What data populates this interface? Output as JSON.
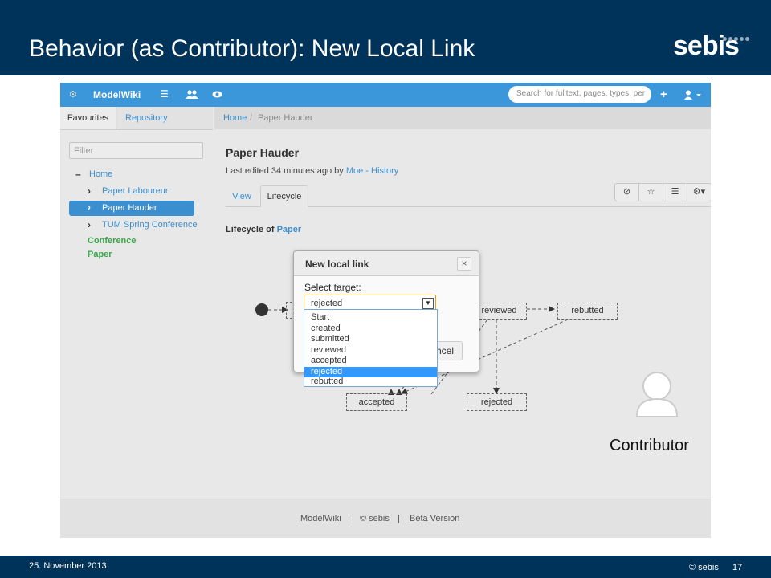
{
  "slide": {
    "title": "Behavior (as Contributor): New Local Link",
    "logo": "sebis",
    "footer_date": "25. November 2013",
    "footer_copyright": "© sebis",
    "page_number": "17"
  },
  "navbar": {
    "brand": "ModelWiki",
    "search_placeholder": "Search for fulltext, pages, types, per",
    "icons": [
      "cogs-icon",
      "list-icon",
      "users-icon",
      "eye-icon",
      "plus-icon",
      "user-icon"
    ]
  },
  "sidebar": {
    "tabs": [
      {
        "label": "Favourites",
        "active": true
      },
      {
        "label": "Repository",
        "active": false
      }
    ],
    "filter_placeholder": "Filter",
    "tree": {
      "root": "Home",
      "children": [
        {
          "label": "Paper Laboureur",
          "selected": false
        },
        {
          "label": "Paper Hauder",
          "selected": true
        },
        {
          "label": "TUM Spring Conference",
          "selected": false
        }
      ]
    },
    "types": [
      "Conference",
      "Paper"
    ]
  },
  "breadcrumb": {
    "home": "Home",
    "separator": "/",
    "current": "Paper Hauder"
  },
  "page": {
    "title": "Paper Hauder",
    "edited_prefix": "Last edited 34 minutes ago by",
    "edited_user": "Moe",
    "edited_sep": "-",
    "history_link": "History",
    "tabs": [
      {
        "label": "View",
        "active": false
      },
      {
        "label": "Lifecycle",
        "active": true
      }
    ],
    "lifecycle_prefix": "Lifecycle of",
    "lifecycle_type": "Paper"
  },
  "lifecycle": {
    "states": [
      "reviewed",
      "rebutted",
      "accepted",
      "rejected"
    ]
  },
  "modal": {
    "title": "New local link",
    "close": "×",
    "select_label": "Select target:",
    "selected_value": "rejected",
    "cancel_label": "ncel",
    "options": [
      "Start",
      "created",
      "submitted",
      "reviewed",
      "accepted",
      "rejected",
      "rebutted"
    ],
    "highlighted_option": "rejected"
  },
  "app_footer": {
    "brand": "ModelWiki",
    "sep": "|",
    "copyright": "© sebis",
    "version": "Beta Version"
  },
  "contributor": {
    "label": "Contributor"
  },
  "colors": {
    "header_bg": "#003359",
    "navbar": "#3b97da",
    "link": "#3b8fcf",
    "type_green": "#3aa64a",
    "highlight": "#3399ff"
  }
}
